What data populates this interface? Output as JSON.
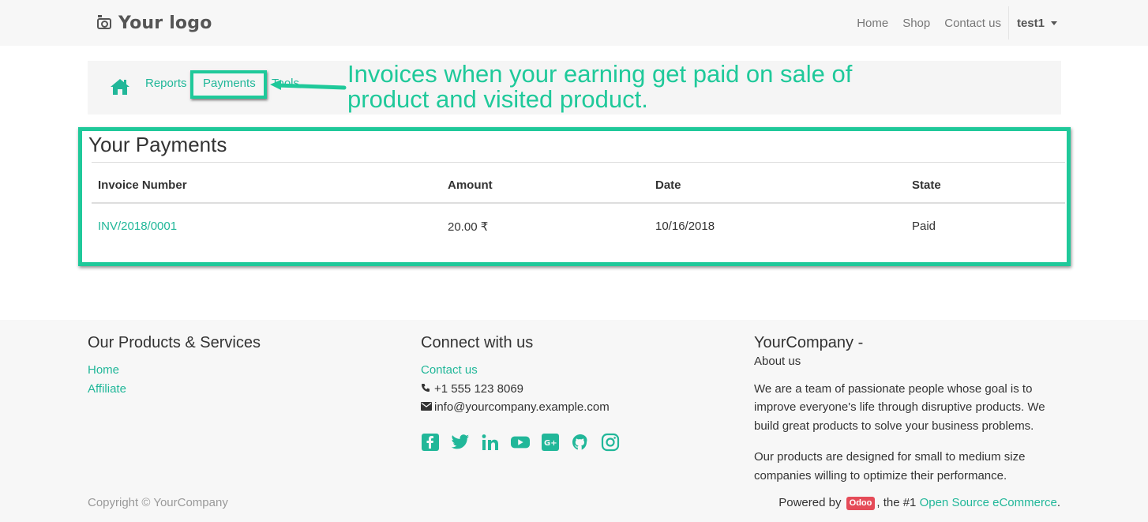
{
  "navbar": {
    "logo_text": "Your logo",
    "links": [
      "Home",
      "Shop",
      "Contact us"
    ],
    "user": "test1"
  },
  "breadcrumb": {
    "items": [
      "Reports",
      "Payments",
      "Tools"
    ]
  },
  "annotation": {
    "text": "Invoices when your earning get paid on sale of product and visited product.",
    "color": "#1fc99a"
  },
  "payments": {
    "title": "Your Payments",
    "columns": [
      "Invoice Number",
      "Amount",
      "Date",
      "State"
    ],
    "rows": [
      {
        "invoice": "INV/2018/0001",
        "amount": "20.00 ₹",
        "date": "10/16/2018",
        "state": "Paid"
      }
    ]
  },
  "footer": {
    "products": {
      "title": "Our Products & Services",
      "links": [
        "Home",
        "Affiliate"
      ]
    },
    "connect": {
      "title": "Connect with us",
      "contact_link": "Contact us",
      "phone": "+1 555 123 8069",
      "email": "info@yourcompany.example.com",
      "social_icons": [
        "facebook-icon",
        "twitter-icon",
        "linkedin-icon",
        "youtube-icon",
        "google-plus-icon",
        "github-icon",
        "instagram-icon"
      ]
    },
    "company": {
      "name": "YourCompany",
      "dash": " - ",
      "about_link": "About us",
      "para1": "We are a team of passionate people whose goal is to improve everyone's life through disruptive products. We build great products to solve your business problems.",
      "para2": "Our products are designed for small to medium size companies willing to optimize their performance."
    },
    "copyright": "Copyright © YourCompany",
    "powered": {
      "prefix": "Powered by ",
      "badge": "Odoo",
      "middle": ", the #1 ",
      "link": "Open Source eCommerce",
      "suffix": "."
    }
  },
  "colors": {
    "accent": "#21b799",
    "highlight": "#1fc99a",
    "odoo_badge": "#e54b58"
  }
}
